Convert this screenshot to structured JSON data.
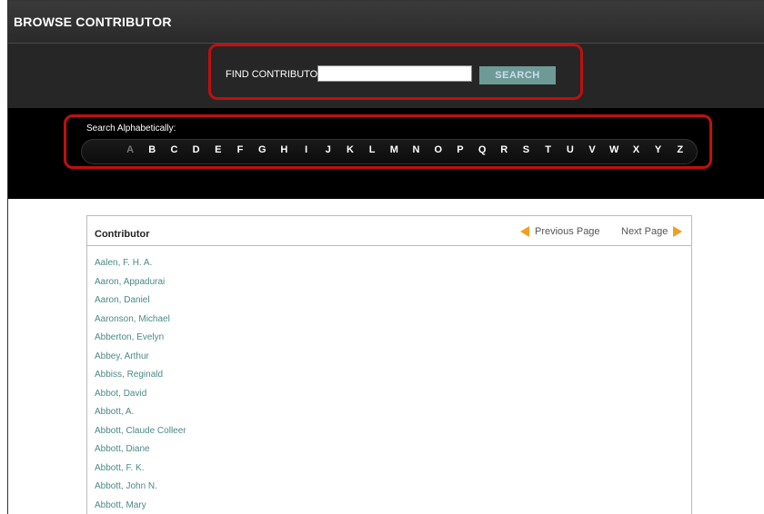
{
  "header": {
    "title": "BROWSE CONTRIBUTOR"
  },
  "search": {
    "label": "FIND CONTRIBUTOR",
    "value": "",
    "button_label": "SEARCH"
  },
  "alphabet": {
    "label": "Search Alphabetically:",
    "letters": [
      "A",
      "B",
      "C",
      "D",
      "E",
      "F",
      "G",
      "H",
      "I",
      "J",
      "K",
      "L",
      "M",
      "N",
      "O",
      "P",
      "Q",
      "R",
      "S",
      "T",
      "U",
      "V",
      "W",
      "X",
      "Y",
      "Z"
    ],
    "active": "A"
  },
  "panel": {
    "title": "Contributor",
    "prev_label": "Previous Page",
    "next_label": "Next Page",
    "contributors": [
      "Aalen, F. H. A.",
      "Aaron, Appadurai",
      "Aaron, Daniel",
      "Aaronson, Michael",
      "Abberton, Evelyn",
      "Abbey, Arthur",
      "Abbiss, Reginald",
      "Abbot, David",
      "Abbott, A.",
      "Abbott, Claude Colleer",
      "Abbott, Diane",
      "Abbott, F. K.",
      "Abbott, John N.",
      "Abbott, Mary"
    ]
  },
  "colors": {
    "accent_link": "#4a8a86",
    "highlight_box": "#c01010",
    "search_button": "#6e9a96",
    "nav_arrow": "#f0a020"
  },
  "icons": {
    "prev": "arrow-left-icon",
    "next": "arrow-right-icon"
  }
}
